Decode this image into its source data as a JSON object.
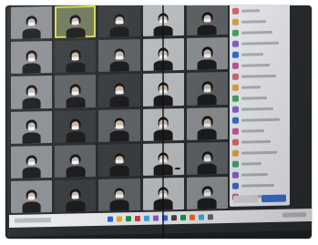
{
  "scene": {
    "type": "photo-of-projected-video-call",
    "participant_tiles": 30,
    "participant_panel_rows": 18
  },
  "colors": {
    "active_speaker_border": "#d7d84a",
    "panel_background": "#eceef1",
    "primary_button": "#3b6fd1",
    "taskbar": "#e7e9ec"
  }
}
